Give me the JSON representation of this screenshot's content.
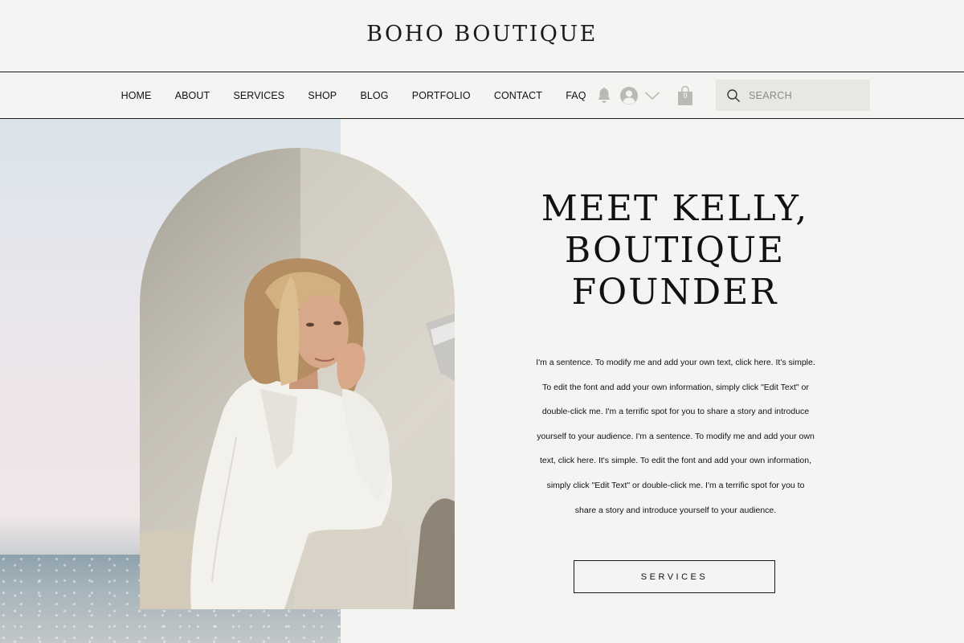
{
  "site": {
    "logo": "BOHO BOUTIQUE"
  },
  "nav": {
    "links": [
      "HOME",
      "ABOUT",
      "SERVICES",
      "SHOP",
      "BLOG",
      "PORTFOLIO",
      "CONTACT",
      "FAQ"
    ],
    "cart_count": "0",
    "search_placeholder": "SEARCH",
    "icons": [
      "bell-icon",
      "avatar-icon",
      "chevron-down-icon",
      "shopping-bag-icon",
      "search-icon"
    ]
  },
  "hero": {
    "title": "MEET KELLY,\nBOUTIQUE\nFOUNDER",
    "body": "I'm a sentence. To modify me and add your own text, click here. It's simple. To edit the font and add your own information, simply click \"Edit Text\" or double-click me. I'm a terrific spot for you to share a story and introduce yourself to your audience. I'm a sentence. To modify me and add your own text, click here. It's simple. To edit the font and add your own information, simply click \"Edit Text\" or double-click me. I'm a terrific spot for you to share a story and introduce yourself to your audience.",
    "button_label": "SERVICES"
  },
  "colors": {
    "page_background": "#f4f4f3",
    "text": "#111111",
    "search_background": "#e8e7e4",
    "icon_gray": "#b9b9b6"
  }
}
